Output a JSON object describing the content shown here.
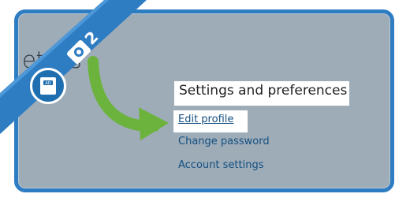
{
  "background_title_fragment": "etails",
  "settings": {
    "title": "Settings and preferences",
    "links": [
      "Edit profile",
      "Change password",
      "Account settings"
    ]
  },
  "ribbon": {
    "step_number": "2",
    "badge_text": "AD"
  },
  "colors": {
    "frame": "#2e7dc3",
    "panel": "#9eacb8",
    "link": "#134f80",
    "arrow": "#6cb33e",
    "ribbon": "#2e7dc3"
  },
  "icons": [
    "camera-icon",
    "address-book-icon",
    "arrow-icon"
  ]
}
